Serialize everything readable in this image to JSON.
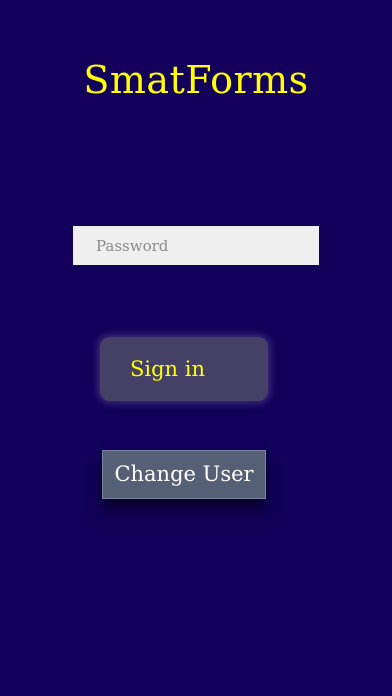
{
  "app": {
    "title": "SmatForms"
  },
  "login": {
    "password_placeholder": "Password",
    "password_value": "",
    "sign_in_label": "Sign in",
    "change_user_label": "Change User"
  },
  "colors": {
    "background": "#12005a",
    "title": "#ffff00",
    "sign_in_text": "#ffff00",
    "sign_in_bg": "#444066",
    "change_user_bg": "#556076",
    "input_bg": "#efefef"
  }
}
